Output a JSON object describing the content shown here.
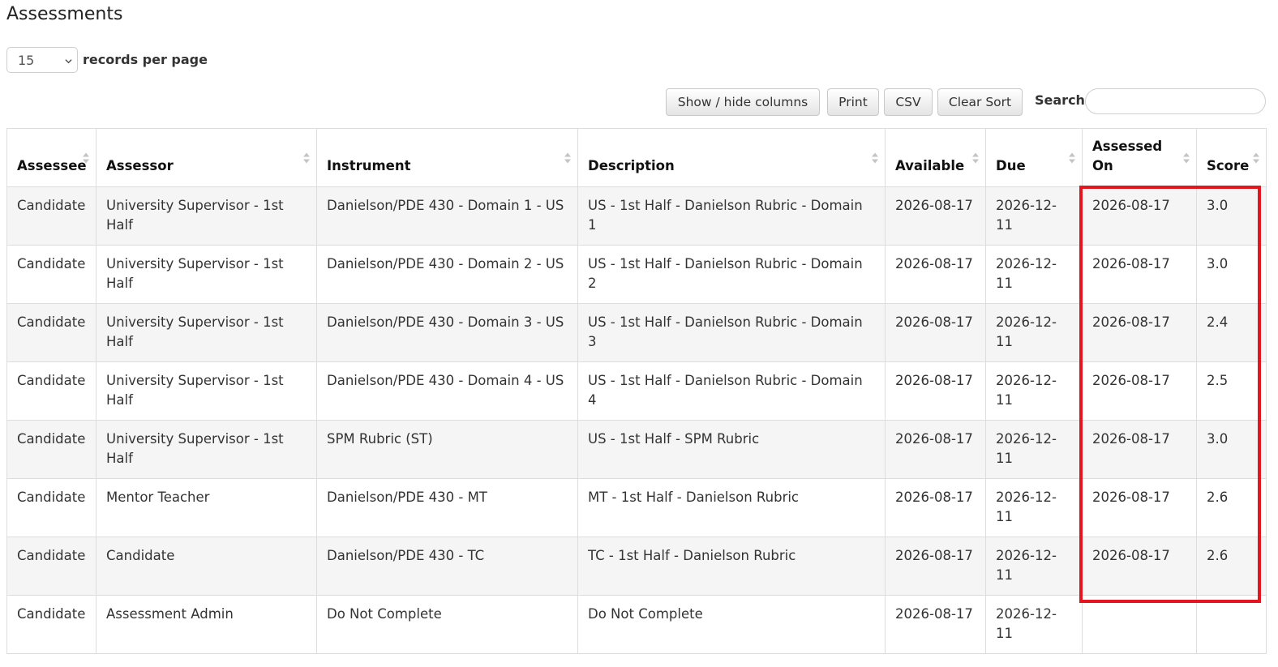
{
  "page": {
    "title": "Assessments"
  },
  "length_menu": {
    "value": "15",
    "label": "records per page"
  },
  "toolbar": {
    "show_hide_label": "Show / hide columns",
    "print_label": "Print",
    "csv_label": "CSV",
    "clear_sort_label": "Clear Sort",
    "search_label": "Search:",
    "search_value": ""
  },
  "table": {
    "headers": [
      "Assessee",
      "Assessor",
      "Instrument",
      "Description",
      "Available",
      "Due",
      "Assessed On",
      "Score"
    ],
    "rows": [
      [
        "Candidate",
        "University Supervisor - 1st Half",
        "Danielson/PDE 430 - Domain 1 - US",
        "US - 1st Half - Danielson Rubric - Domain 1",
        "2026-08-17",
        "2026-12-11",
        "2026-08-17",
        "3.0"
      ],
      [
        "Candidate",
        "University Supervisor - 1st Half",
        "Danielson/PDE 430 - Domain 2 - US",
        "US - 1st Half - Danielson Rubric - Domain 2",
        "2026-08-17",
        "2026-12-11",
        "2026-08-17",
        "3.0"
      ],
      [
        "Candidate",
        "University Supervisor - 1st Half",
        "Danielson/PDE 430 - Domain 3 - US",
        "US - 1st Half - Danielson Rubric - Domain 3",
        "2026-08-17",
        "2026-12-11",
        "2026-08-17",
        "2.4"
      ],
      [
        "Candidate",
        "University Supervisor - 1st Half",
        "Danielson/PDE 430 - Domain 4 - US",
        "US - 1st Half - Danielson Rubric - Domain 4",
        "2026-08-17",
        "2026-12-11",
        "2026-08-17",
        "2.5"
      ],
      [
        "Candidate",
        "University Supervisor - 1st Half",
        "SPM Rubric (ST)",
        "US - 1st Half - SPM Rubric",
        "2026-08-17",
        "2026-12-11",
        "2026-08-17",
        "3.0"
      ],
      [
        "Candidate",
        "Mentor Teacher",
        "Danielson/PDE 430 - MT",
        "MT - 1st Half - Danielson Rubric",
        "2026-08-17",
        "2026-12-11",
        "2026-08-17",
        "2.6"
      ],
      [
        "Candidate",
        "Candidate",
        "Danielson/PDE 430 - TC",
        "TC - 1st Half - Danielson Rubric",
        "2026-08-17",
        "2026-12-11",
        "2026-08-17",
        "2.6"
      ],
      [
        "Candidate",
        "Assessment Admin",
        "Do Not Complete",
        "Do Not Complete",
        "2026-08-17",
        "2026-12-11",
        "",
        ""
      ]
    ]
  },
  "icons": {
    "sort": "sort-both-icon",
    "select": "chevron-down-icon"
  },
  "colors": {
    "highlight": "#e3161d",
    "row_stripe": "#f5f5f5"
  }
}
